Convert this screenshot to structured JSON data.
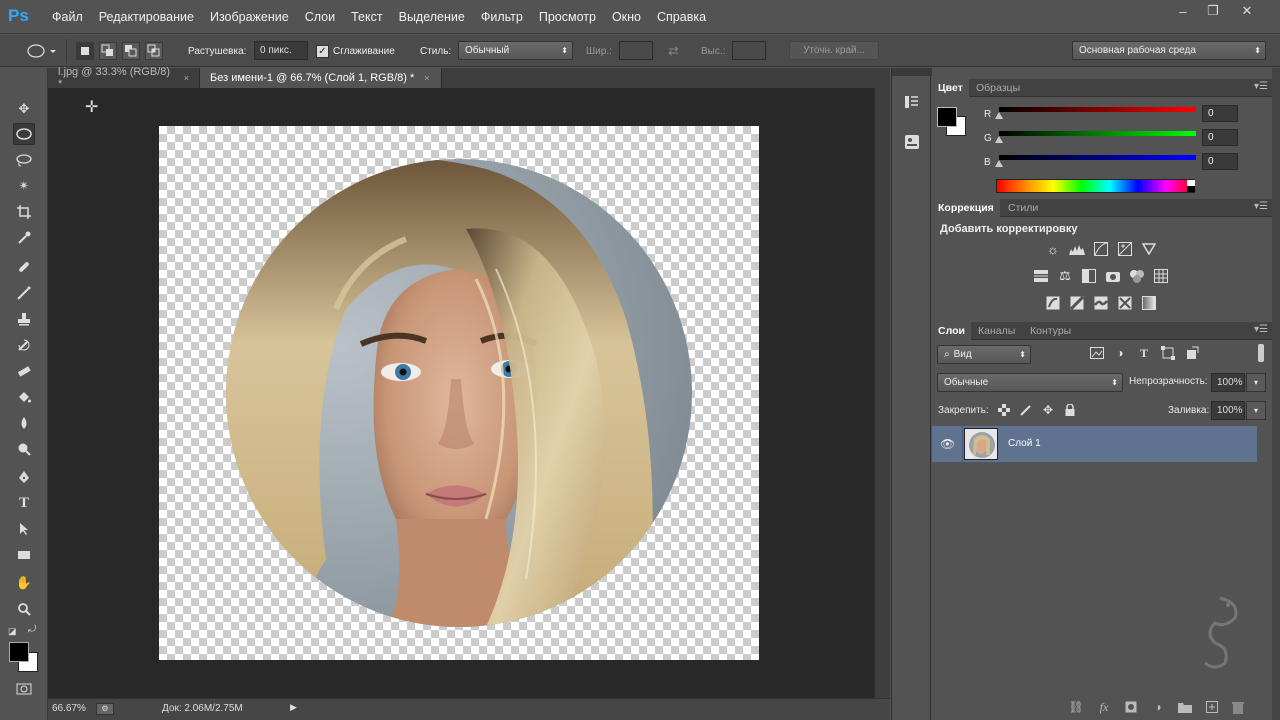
{
  "app": {
    "logo": "Ps"
  },
  "menu": [
    "Файл",
    "Редактирование",
    "Изображение",
    "Слои",
    "Текст",
    "Выделение",
    "Фильтр",
    "Просмотр",
    "Окно",
    "Справка"
  ],
  "window_controls": {
    "minimize": "–",
    "restore": "❐",
    "close": "✕"
  },
  "options": {
    "feather_label": "Растушевка:",
    "feather_value": "0 пикс.",
    "antialias_label": "Сглаживание",
    "antialias_checked": true,
    "style_label": "Стиль:",
    "style_value": "Обычный",
    "width_label": "Шир.:",
    "height_label": "Выс.:",
    "refine_edge": "Уточн. край...",
    "workspace": "Основная рабочая среда"
  },
  "tabs": [
    {
      "label": "l.jpg @ 33.3% (RGB/8) *",
      "close": "×",
      "active": false
    },
    {
      "label": "Без имени-1 @ 66.7% (Слой 1, RGB/8) *",
      "close": "×",
      "active": true
    }
  ],
  "status": {
    "zoom": "66.67%",
    "doc": "Док: 2.06M/2.75M"
  },
  "color_panel": {
    "tabs": [
      "Цвет",
      "Образцы"
    ],
    "r_label": "R",
    "g_label": "G",
    "b_label": "B",
    "r": 0,
    "g": 0,
    "b": 0,
    "r_text": "0",
    "g_text": "0",
    "b_text": "0",
    "foreground": "#000000",
    "background": "#ffffff"
  },
  "adjust_panel": {
    "tabs": [
      "Коррекция",
      "Стили"
    ],
    "title": "Добавить корректировку"
  },
  "layers_panel": {
    "tabs": [
      "Слои",
      "Каналы",
      "Контуры"
    ],
    "filter_kind": "Вид",
    "blend_mode": "Обычные",
    "opacity_label": "Непрозрачность:",
    "opacity_value": "100%",
    "lock_label": "Закрепить:",
    "fill_label": "Заливка:",
    "fill_value": "100%",
    "layers": [
      {
        "name": "Слой 1",
        "visible": true,
        "selected": true
      }
    ]
  },
  "colors": {
    "accent": "#30a8ff",
    "selected_layer": "#5f7290"
  }
}
